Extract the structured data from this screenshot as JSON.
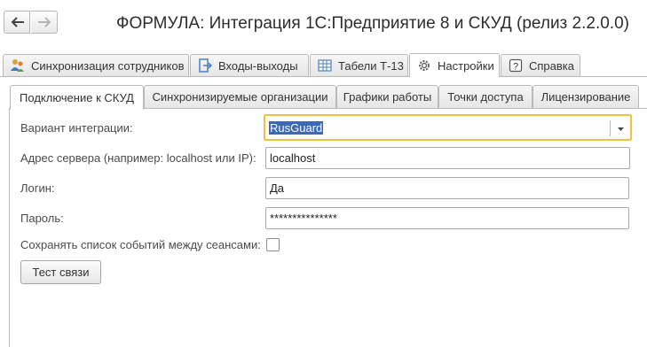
{
  "window": {
    "title": "ФОРМУЛА: Интеграция 1С:Предприятие 8 и СКУД (релиз 2.2.0.0)"
  },
  "top_tabs": [
    {
      "label": "Синхронизация сотрудников",
      "icon": "users-sync-icon"
    },
    {
      "label": "Входы-выходы",
      "icon": "entry-exit-icon"
    },
    {
      "label": "Табели Т-13",
      "icon": "table-grid-icon"
    },
    {
      "label": "Настройки",
      "icon": "gear-icon",
      "active": true
    },
    {
      "label": "Справка",
      "icon": "help-icon"
    }
  ],
  "inner_tabs": [
    {
      "label": "Подключение к СКУД",
      "active": true
    },
    {
      "label": "Синхронизируемые организации"
    },
    {
      "label": "Графики работы"
    },
    {
      "label": "Точки доступа"
    },
    {
      "label": "Лицензирование"
    }
  ],
  "form": {
    "integration_variant": {
      "label": "Вариант интеграции:",
      "value": "RusGuard"
    },
    "server_address": {
      "label": "Адрес сервера (например: localhost или IP):",
      "value": "localhost"
    },
    "login": {
      "label": "Логин:",
      "value": "Да"
    },
    "password": {
      "label": "Пароль:",
      "value": "***************"
    },
    "save_events": {
      "label": "Сохранять список событий между сеансами:",
      "checked": false
    },
    "test_button": "Тест связи"
  },
  "colors": {
    "focus_border": "#f0c040",
    "selection": "#3b69b5"
  }
}
